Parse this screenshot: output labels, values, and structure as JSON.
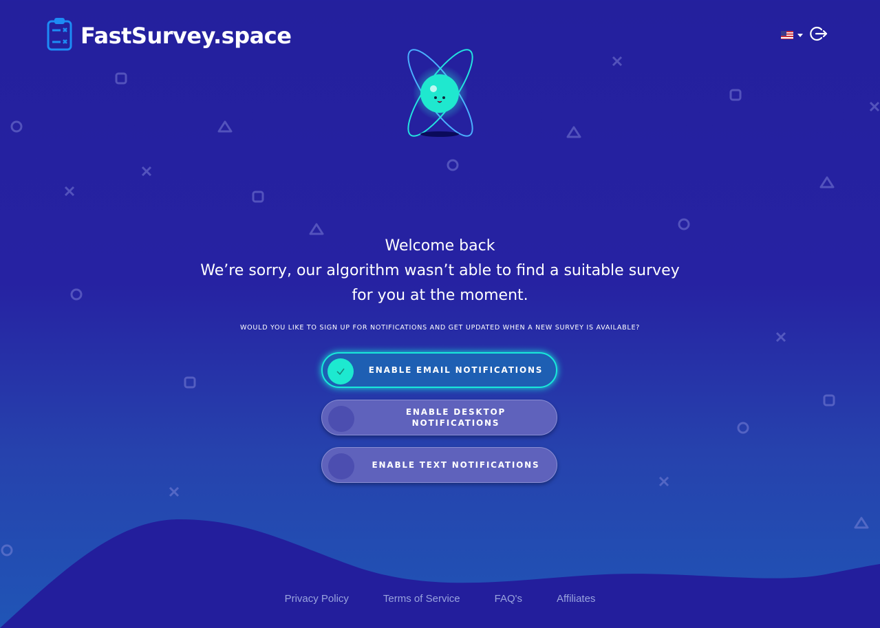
{
  "brand": {
    "name": "FastSurvey.space",
    "icon": "clipboard-icon"
  },
  "header": {
    "language_icon": "us-flag-icon",
    "logout_icon": "logout-icon"
  },
  "welcome": {
    "line1": "Welcome back",
    "line2": "We’re sorry, our algorithm wasn’t able to find a suitable survey",
    "line3": "for you at the moment."
  },
  "prompt": "WOULD YOU LIKE TO SIGN UP FOR NOTIFICATIONS AND GET UPDATED WHEN A NEW SURVEY IS AVAILABLE?",
  "toggles": [
    {
      "label": "ENABLE EMAIL NOTIFICATIONS",
      "enabled": true
    },
    {
      "label": "ENABLE DESKTOP NOTIFICATIONS",
      "enabled": false
    },
    {
      "label": "ENABLE TEXT NOTIFICATIONS",
      "enabled": false
    }
  ],
  "footer": {
    "links": [
      "Privacy Policy",
      "Terms of Service",
      "FAQ's",
      "Affiliates"
    ]
  },
  "colors": {
    "accent": "#19e8da",
    "background": "#24209d",
    "toggle_off": "#5f62bc"
  }
}
